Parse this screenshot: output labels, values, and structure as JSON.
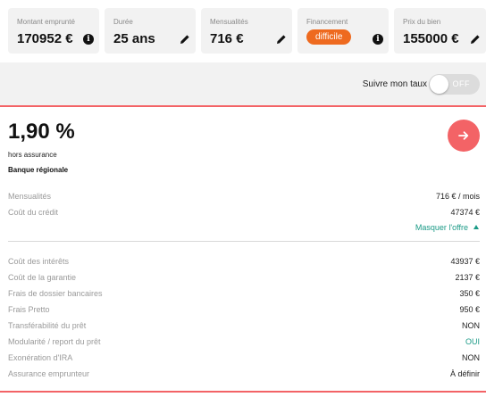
{
  "summary": {
    "montant": {
      "label": "Montant emprunté",
      "value": "170952 €",
      "icon": "info-icon"
    },
    "duree": {
      "label": "Durée",
      "value": "25 ans",
      "icon": "pencil-icon"
    },
    "mensualites": {
      "label": "Mensualités",
      "value": "716 €",
      "icon": "pencil-icon"
    },
    "financement": {
      "label": "Financement",
      "value": "difficile",
      "icon": "info-icon",
      "badge_color": "#ee6a1f"
    },
    "prix": {
      "label": "Prix du bien",
      "value": "155000 €",
      "icon": "pencil-icon"
    }
  },
  "follow": {
    "label": "Suivre mon taux",
    "toggle_state": "OFF"
  },
  "offer": {
    "rate": "1,90 %",
    "rate_note": "hors assurance",
    "bank": "Banque régionale",
    "accent_color": "#f36366",
    "details_top": [
      {
        "label": "Mensualités",
        "value": "716 € / mois"
      },
      {
        "label": "Coût du crédit",
        "value": "47374 €"
      }
    ],
    "toggle_details_label": "Masquer l'offre",
    "details": [
      {
        "label": "Coût des intérêts",
        "value": "43937 €"
      },
      {
        "label": "Coût de la garantie",
        "value": "2137 €"
      },
      {
        "label": "Frais de dossier bancaires",
        "value": "350 €"
      },
      {
        "label": "Frais Pretto",
        "value": "950 €"
      },
      {
        "label": "Transférabilité du prêt",
        "value": "NON"
      },
      {
        "label": "Modularité / report du prêt",
        "value": "OUI"
      },
      {
        "label": "Exonération d'IRA",
        "value": "NON"
      },
      {
        "label": "Assurance emprunteur",
        "value": "À définir"
      }
    ]
  }
}
